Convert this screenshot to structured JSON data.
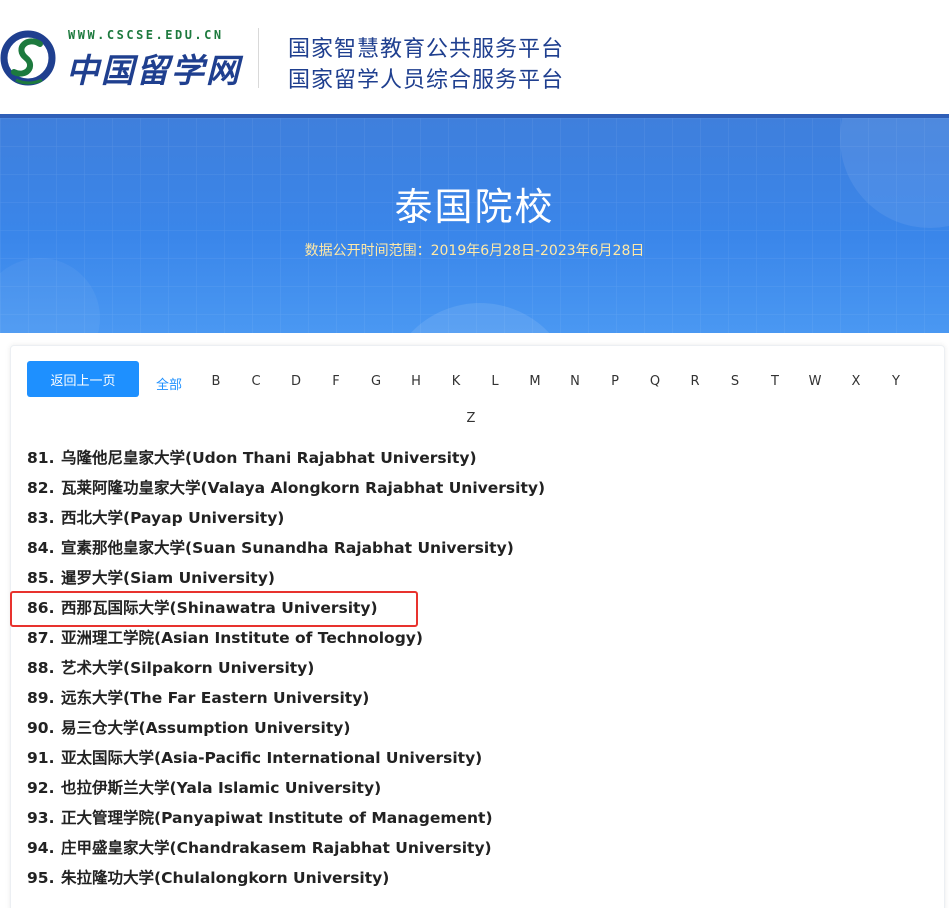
{
  "header": {
    "logo_url": "WWW.CSCSE.EDU.CN",
    "logo_text": "中国留学网",
    "platform_line1": "国家智慧教育公共服务平台",
    "platform_line2": "国家留学人员综合服务平台",
    "brand_color": "#1f3f8f",
    "logo_green": "#1d7a3e"
  },
  "banner": {
    "title": "泰国院校",
    "subtitle": "数据公开时间范围：2019年6月28日-2023年6月28日",
    "bg_color": "#3a86ea",
    "subtitle_color": "#ffe9a6"
  },
  "filter": {
    "back_label": "返回上一页",
    "all_label": "全部",
    "letters": [
      "B",
      "C",
      "D",
      "F",
      "G",
      "H",
      "K",
      "L",
      "M",
      "N",
      "P",
      "Q",
      "R",
      "S",
      "T",
      "W",
      "X",
      "Y",
      "Z"
    ],
    "active": "全部",
    "accent_color": "#1e90ff"
  },
  "schools": [
    {
      "num": "81.",
      "name": "乌隆他尼皇家大学(Udon Thani Rajabhat University)"
    },
    {
      "num": "82.",
      "name": "瓦莱阿隆功皇家大学(Valaya Alongkorn Rajabhat University)"
    },
    {
      "num": "83.",
      "name": "西北大学(Payap University)"
    },
    {
      "num": "84.",
      "name": "宣素那他皇家大学(Suan Sunandha Rajabhat University)"
    },
    {
      "num": "85.",
      "name": "暹罗大学(Siam University)"
    },
    {
      "num": "86.",
      "name": "西那瓦国际大学(Shinawatra University)"
    },
    {
      "num": "87.",
      "name": "亚洲理工学院(Asian Institute of Technology)"
    },
    {
      "num": "88.",
      "name": "艺术大学(Silpakorn University)"
    },
    {
      "num": "89.",
      "name": "远东大学(The Far Eastern University)"
    },
    {
      "num": "90.",
      "name": "易三仓大学(Assumption University)"
    },
    {
      "num": "91.",
      "name": "亚太国际大学(Asia-Pacific International University)"
    },
    {
      "num": "92.",
      "name": "也拉伊斯兰大学(Yala Islamic University)"
    },
    {
      "num": "93.",
      "name": "正大管理学院(Panyapiwat Institute of Management)"
    },
    {
      "num": "94.",
      "name": "庄甲盛皇家大学(Chandrakasem Rajabhat University)"
    },
    {
      "num": "95.",
      "name": "朱拉隆功大学(Chulalongkorn University)"
    }
  ],
  "highlighted_school": "86.",
  "highlight_color": "#e8332e"
}
